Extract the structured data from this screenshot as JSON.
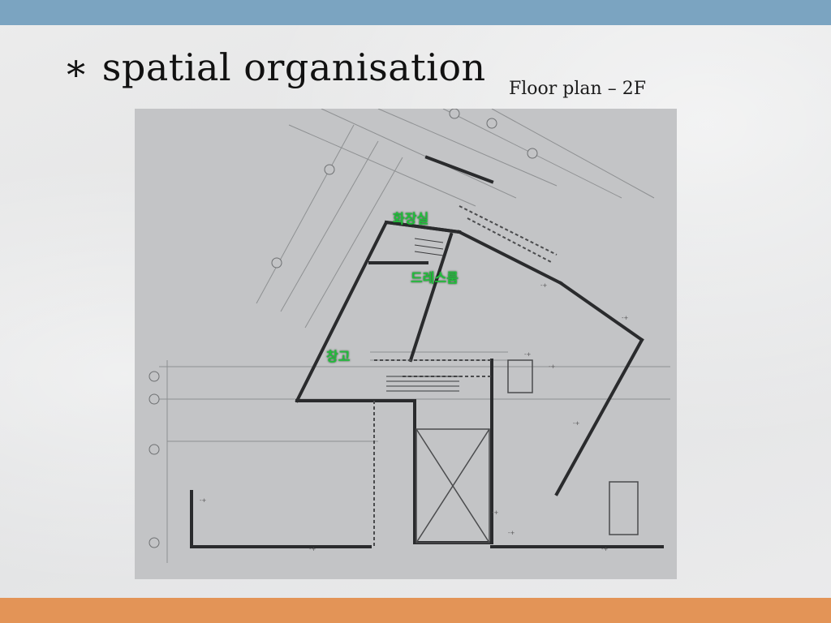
{
  "slide": {
    "bullet": "∗",
    "title": "spatial organisation",
    "caption": "Floor plan – 2F"
  },
  "floor_plan": {
    "room_labels": [
      "화장실",
      "드레스룸",
      "창고"
    ]
  },
  "colors": {
    "top_band": "#7ba4c1",
    "bottom_band": "#e39457",
    "room_label": "#1fbf3a"
  }
}
